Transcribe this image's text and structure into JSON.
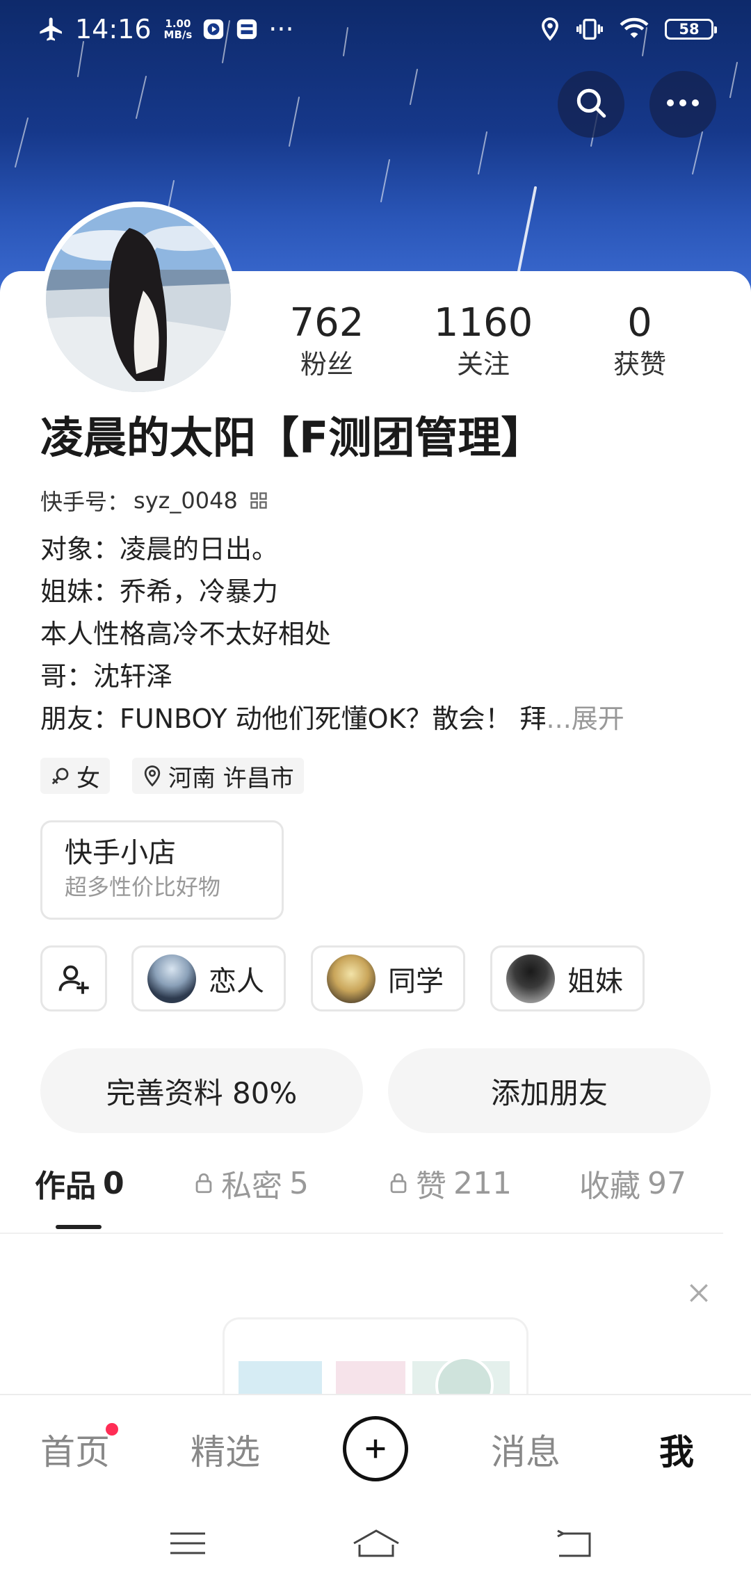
{
  "status_bar": {
    "time": "14:16",
    "speed_value": "1.00",
    "speed_unit": "MB/s",
    "more": "···",
    "battery": "58"
  },
  "header": {
    "search_icon": "search-icon",
    "more_icon": "more-horizontal-icon"
  },
  "profile": {
    "stats": [
      {
        "value": "762",
        "label": "粉丝"
      },
      {
        "value": "1160",
        "label": "关注"
      },
      {
        "value": "0",
        "label": "获赞"
      }
    ],
    "name": "凌晨的太阳【F测团管理】",
    "kuaishou_id_label": "快手号：",
    "kuaishou_id": "syz_0048",
    "bio": [
      "对象：凌晨的日出。",
      "姐妹：乔希，冷暴力",
      "本人性格高冷不太好相处",
      "哥：沈轩泽",
      "朋友：FUNBOY 动他们死懂OK？散会！  拜"
    ],
    "bio_ellipsis": "...",
    "bio_expand": "展开",
    "tags": [
      {
        "icon": "gender-female-icon",
        "label": "女"
      },
      {
        "icon": "location-pin-icon",
        "label": "河南 许昌市"
      }
    ]
  },
  "shop": {
    "title": "快手小店",
    "subtitle": "超多性价比好物"
  },
  "relations": [
    {
      "label": "恋人",
      "color": "#2d3a4e"
    },
    {
      "label": "同学",
      "color": "#c9a55a"
    },
    {
      "label": "姐妹",
      "color": "#3a3a3a"
    }
  ],
  "actions": {
    "complete_profile": "完善资料 80%",
    "add_friend": "添加朋友"
  },
  "tabs": [
    {
      "label": "作品",
      "count": "0",
      "locked": false,
      "active": true
    },
    {
      "label": "私密",
      "count": "5",
      "locked": true,
      "active": false
    },
    {
      "label": "赞",
      "count": "211",
      "locked": true,
      "active": false
    },
    {
      "label": "收藏",
      "count": "97",
      "locked": false,
      "active": false
    }
  ],
  "bottom_nav": [
    {
      "label": "首页",
      "active": false,
      "badge": true
    },
    {
      "label": "精选",
      "active": false,
      "badge": false
    },
    {
      "label": "消息",
      "active": false,
      "badge": false
    },
    {
      "label": "我",
      "active": true,
      "badge": false
    }
  ],
  "colors": {
    "banner_top": "#0e2a6b",
    "banner_bottom": "#3b6ad0",
    "badge_red": "#ff2d55",
    "text_primary": "#222222",
    "text_secondary": "#999999"
  }
}
